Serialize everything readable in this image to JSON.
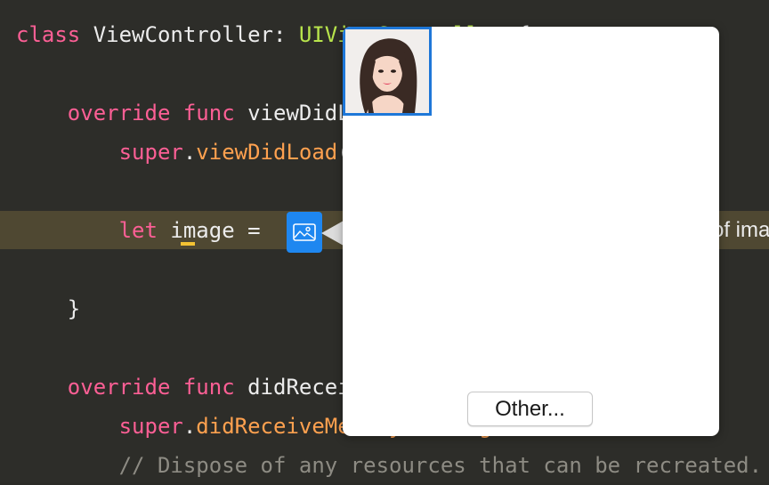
{
  "editor": {
    "lines": [
      {
        "parts": [
          {
            "t": "class",
            "c": "kw"
          },
          {
            "t": " ViewController: ",
            "c": "wh"
          },
          {
            "t": "UIViewController",
            "c": "ty"
          },
          {
            "t": " {",
            "c": "wh"
          }
        ]
      },
      {
        "parts": []
      },
      {
        "parts": [
          {
            "t": "    override func",
            "c": "kw"
          },
          {
            "t": " viewDidLoad() {",
            "c": "wh"
          }
        ]
      },
      {
        "parts": [
          {
            "t": "        super",
            "c": "kw"
          },
          {
            "t": ".",
            "c": "wh"
          },
          {
            "t": "viewDidLoad",
            "c": "fn"
          },
          {
            "t": "()",
            "c": "wh"
          }
        ]
      },
      {
        "parts": []
      },
      {
        "parts": [
          {
            "t": "        let",
            "c": "kw"
          },
          {
            "t": " image = ",
            "c": "wh"
          }
        ]
      },
      {
        "parts": []
      },
      {
        "parts": [
          {
            "t": "    }",
            "c": "wh"
          }
        ]
      },
      {
        "parts": []
      },
      {
        "parts": [
          {
            "t": "    override func",
            "c": "kw"
          },
          {
            "t": " didReceiveMemoryWarning() {",
            "c": "wh"
          }
        ]
      },
      {
        "parts": [
          {
            "t": "        super",
            "c": "kw"
          },
          {
            "t": ".",
            "c": "wh"
          },
          {
            "t": "didReceiveMemoryWarning",
            "c": "fn"
          },
          {
            "t": "()",
            "c": "wh"
          }
        ]
      },
      {
        "parts": [
          {
            "t": "        // Dispose of any resources that can be recreated.",
            "c": "cm"
          }
        ]
      }
    ],
    "trailing_text": "of imag"
  },
  "popover": {
    "other_button_label": "Other..."
  },
  "colors": {
    "background": "#2d2d29",
    "highlight_line": "#4f4832",
    "keyword": "#fc5f95",
    "function": "#ffa14f",
    "type": "#b8e44c",
    "comment": "#8d8b83",
    "accent_blue": "#1e87f0"
  },
  "icons": {
    "literal_button": "image-icon"
  }
}
